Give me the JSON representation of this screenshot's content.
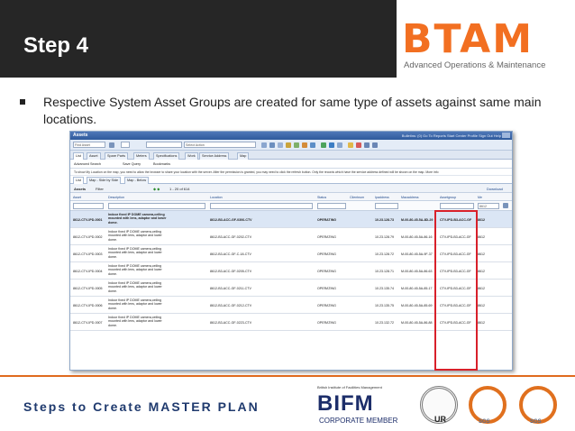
{
  "slide": {
    "step_title": "Step 4",
    "bullet": "Respective System Asset Groups are created for same type of assets against same main locations.",
    "footer_title": "Steps to Create MASTER PLAN"
  },
  "logo": {
    "letters": "BTAM",
    "subtitle": "Advanced Operations & Maintenance",
    "color": "#f26f21"
  },
  "badges": {
    "bifm_top": "British Institute of Facilities Management",
    "bifm_main": "BIFM",
    "bifm_sub": "CORPORATE MEMBER",
    "ur_label": "UR",
    "sgs_1": "SGS",
    "sgs_2": "SGS"
  },
  "screenshot": {
    "window_title": "Assets",
    "top_links": "Bulletins: (0)   Go To   Reports   Start Center   Profile   Sign Out   Help",
    "find_placeholder": "Find Asset",
    "select_action": "Select Action",
    "tabs": [
      "List",
      "Asset",
      "Spare Parts",
      "Meters",
      "Specifications",
      "Work",
      "Service Address",
      "Map"
    ],
    "advanced_search": "Advanced Search",
    "save_query": "Save Query",
    "bookmarks": "Bookmarks",
    "info_text": "To show My Location on the map, you need to allow the browser to share your location with the server. After the permission is granted, you may need to click the refresh button. Only the records which have the service address defined will be shown on the map. More info",
    "subtabs": [
      "List",
      "Map - Side by Side",
      "Map - Below"
    ],
    "list_label": "Assets",
    "filter_label": "Filter",
    "pager": "1 - 20 of 614",
    "download": "Download",
    "columns": [
      "Asset",
      "Description",
      "Location",
      "Status",
      "Clientnum",
      "Ipaddress",
      "Macaddress",
      "Assetgroup",
      "Me"
    ],
    "filter_value": "8612",
    "rows": [
      {
        "asset": "8612-CTV-IPD-0001",
        "desc": "Indoor fixed IP DOME camera,ceiling mounted with lens, adaptor and lower dome.",
        "loc": "8612-B3-ACC-GF-0306-CTV",
        "status": "OPERATING",
        "ip": "10.23.128.73",
        "mac": "M-00-80-45-5A-8D-29",
        "grp": "CTV-IPD-B3-ACC-GF",
        "me": "8612"
      },
      {
        "asset": "8612-CTV-IPD-0002",
        "desc": "Indoor fixed IP DOME camera,ceiling mounted with lens, adaptor and lower dome.",
        "loc": "8612-B3-ACC-GF-0202-CTV",
        "status": "OPERATING",
        "ip": "10.23.128.79",
        "mac": "M-00-80-45-5A-86-16",
        "grp": "CTV-IPD-B3-ACC-GF",
        "me": "8612"
      },
      {
        "asset": "8612-CTV-IPD-0003",
        "desc": "Indoor fixed IP DOME camera,ceiling mounted with lens, adaptor and lower dome.",
        "loc": "8612-B3-ACC-GF-C-18-CTV",
        "status": "OPERATING",
        "ip": "10.23.128.72",
        "mac": "M-00-80-45-5A-9F-37",
        "grp": "CTV-IPD-B3-ACC-GF",
        "me": "8612"
      },
      {
        "asset": "8612-CTV-IPD-0004",
        "desc": "Indoor fixed IP DOME camera,ceiling mounted with lens, adaptor and lower dome.",
        "loc": "8612-B3-ACC-GF-0205-CTV",
        "status": "OPERATING",
        "ip": "10.23.128.71",
        "mac": "M-00-80-45-5A-86-63",
        "grp": "CTV-IPD-B3-ACC-GF",
        "me": "8612"
      },
      {
        "asset": "8612-CTV-IPD-0005",
        "desc": "Indoor fixed IP DOME camera,ceiling mounted with lens, adaptor and lower dome.",
        "loc": "8612-B3-ACC-GF-0211-CTV",
        "status": "OPERATING",
        "ip": "10.23.135.74",
        "mac": "M-00-80-45-5A-85-17",
        "grp": "CTV-IPD-B3-ACC-GF",
        "me": "8612"
      },
      {
        "asset": "8612-CTV-IPD-0006",
        "desc": "Indoor fixed IP DOME camera,ceiling mounted with lens, adaptor and lower dome.",
        "loc": "8612-B3-ACC-GF-0212-CTV",
        "status": "OPERATING",
        "ip": "10.23.135.75",
        "mac": "M-00-80-45-5A-85-69",
        "grp": "CTV-IPD-B3-ACC-GF",
        "me": "8612"
      },
      {
        "asset": "8612-CTV-IPD-0007",
        "desc": "Indoor fixed IP DOME camera,ceiling mounted with lens, adaptor and lower dome.",
        "loc": "8612-B3-ACC-GF-0223-CTV",
        "status": "OPERATING",
        "ip": "10.23.132.72",
        "mac": "M-00-80-45-5A-86-88",
        "grp": "CTV-IPD-B3-ACC-GF",
        "me": "8612"
      }
    ]
  }
}
